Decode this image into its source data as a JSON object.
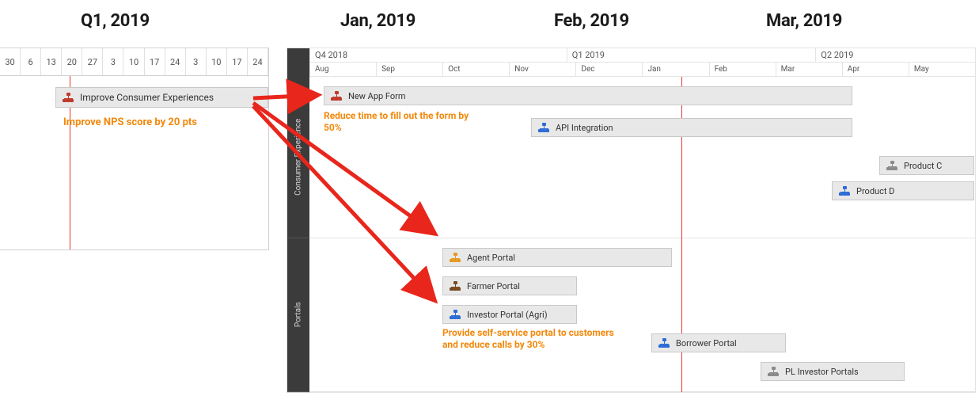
{
  "headers": {
    "q1": "Q1, 2019",
    "jan": "Jan, 2019",
    "feb": "Feb, 2019",
    "mar": "Mar, 2019"
  },
  "left": {
    "dates": [
      "30",
      "6",
      "13",
      "20",
      "27",
      "3",
      "10",
      "17",
      "24",
      "3",
      "10",
      "17",
      "24"
    ],
    "bar_label": "Improve Consumer Experiences",
    "note": "Improve NPS score by 20 pts"
  },
  "right": {
    "quarters": [
      "Q4 2018",
      "Q1 2019",
      "Q2 2019"
    ],
    "months": [
      "Aug",
      "Sep",
      "Oct",
      "Nov",
      "Dec",
      "Jan",
      "Feb",
      "Mar",
      "Apr",
      "May"
    ],
    "lanes": {
      "consumer": "Consumer Experience",
      "portals": "Portals"
    },
    "bars": {
      "new_app_form": "New App Form",
      "api_integration": "API Integration",
      "product_c": "Product C",
      "product_d": "Product D",
      "agent_portal": "Agent Portal",
      "farmer_portal": "Farmer Portal",
      "investor_portal_agri": "Investor Portal (Agri)",
      "borrower_portal": "Borrower Portal",
      "pl_investor_portals": "PL Investor Portals"
    },
    "notes": {
      "form": "Reduce time to fill out the form by 50%",
      "portal": "Provide self-service portal to customers and reduce calls by 30%"
    }
  }
}
